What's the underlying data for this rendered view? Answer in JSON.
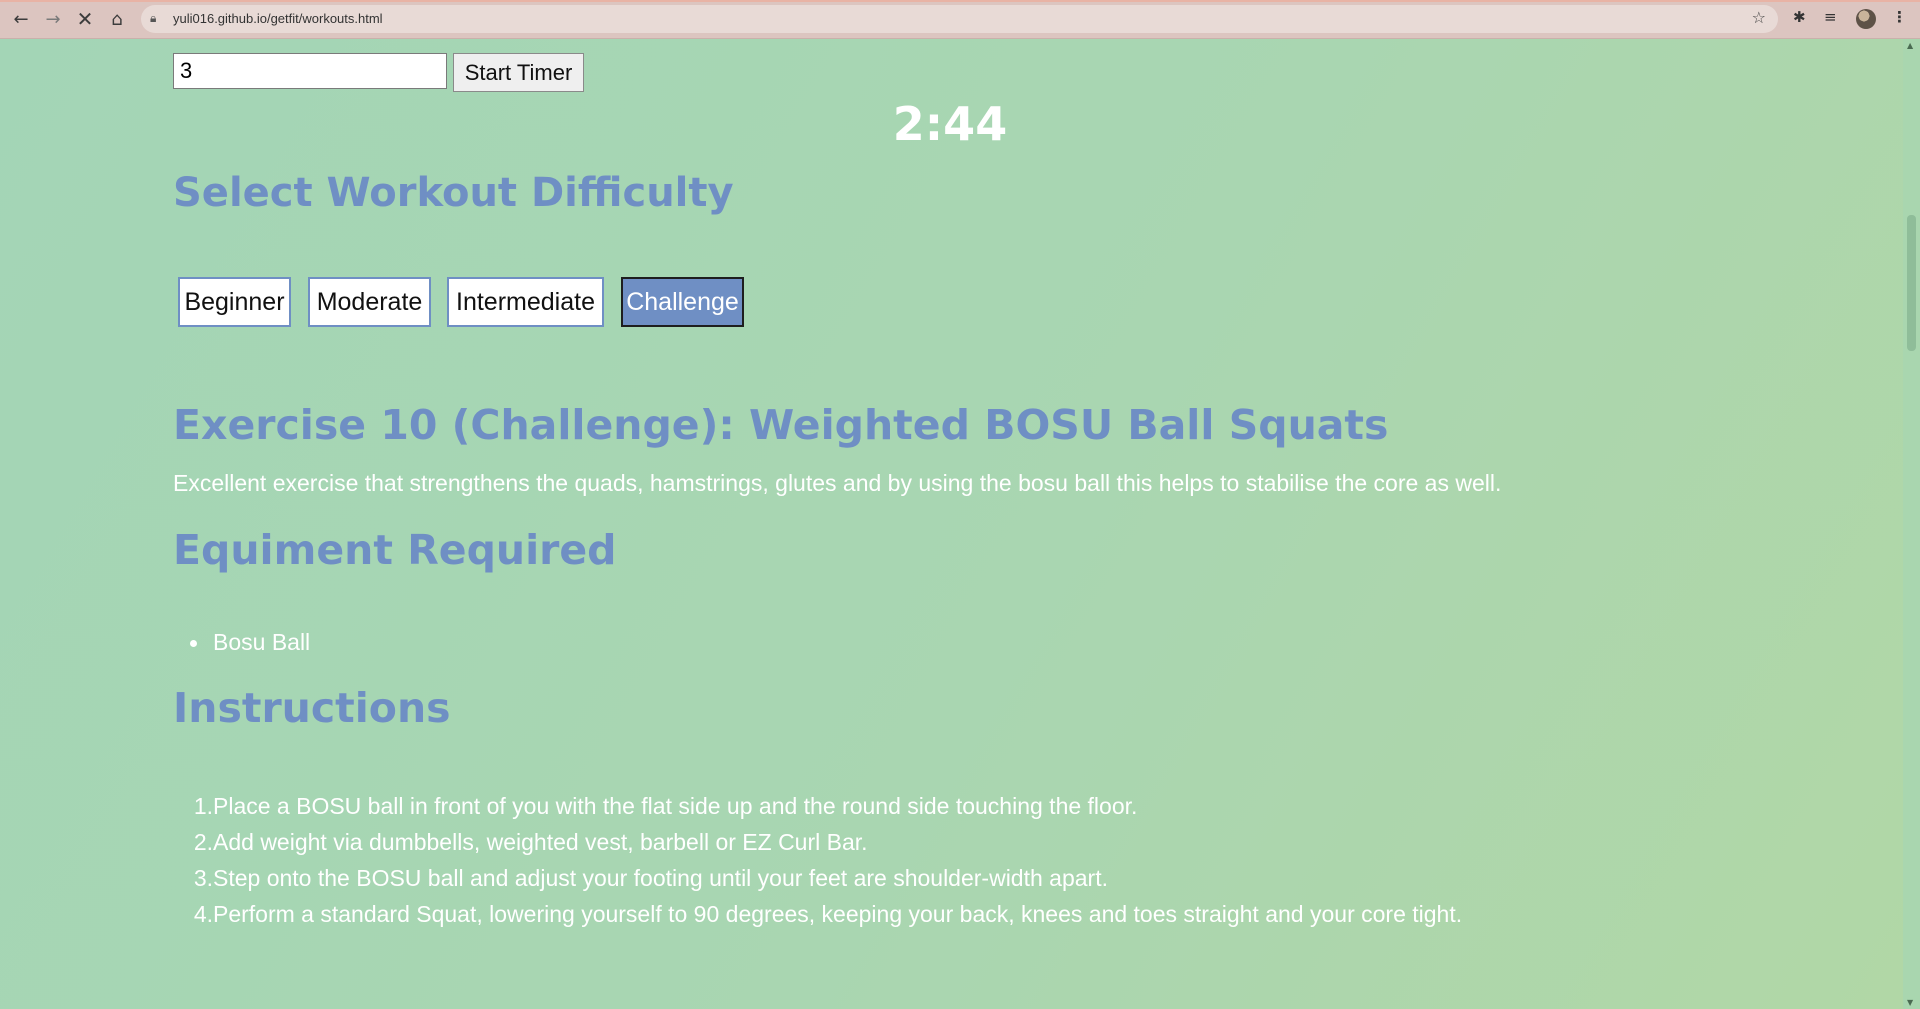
{
  "browser": {
    "url": "yuli016.github.io/getfit/workouts.html"
  },
  "timer": {
    "minutes_value": "3",
    "start_label": "Start Timer",
    "countdown": "2:44"
  },
  "difficulty": {
    "heading": "Select Workout Difficulty",
    "buttons": [
      "Beginner",
      "Moderate",
      "Intermediate",
      "Challenge"
    ],
    "selected": "Challenge"
  },
  "exercise": {
    "title": "Exercise 10 (Challenge): Weighted BOSU Ball Squats",
    "description": "Excellent exercise that strengthens the quads, hamstrings, glutes and by using the bosu ball this helps to stabilise the core as well.",
    "equipment_heading": "Equiment Required",
    "equipment": [
      "Bosu Ball"
    ],
    "instructions_heading": "Instructions",
    "steps": [
      "Place a BOSU ball in front of you with the flat side up and the round side touching the floor.",
      "Add weight via dumbbells, weighted vest, barbell or EZ Curl Bar.",
      "Step onto the BOSU ball and adjust your footing until your feet are shoulder-width apart.",
      "Perform a standard Squat, lowering yourself to 90 degrees, keeping your back, knees and toes straight and your core tight."
    ]
  },
  "colors": {
    "heading": "#6f8fc4",
    "background": "#a6d7b7",
    "active_button": "#6f8fc4"
  }
}
